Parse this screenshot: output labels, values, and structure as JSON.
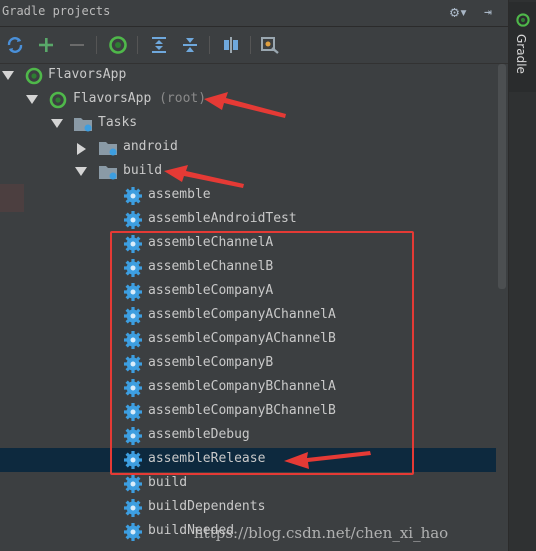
{
  "panel": {
    "title": "Gradle projects",
    "settings_icon": "gear-icon",
    "hide_icon": "hide-panel-icon",
    "side_tab_label": "Gradle"
  },
  "toolbar": {
    "icons": [
      "refresh-icon",
      "add-icon",
      "remove-icon",
      "gradle-execute-icon",
      "expand-all-icon",
      "collapse-all-icon",
      "attach-icon",
      "settings-wrench-icon"
    ]
  },
  "tree": {
    "root_label": "FlavorsApp",
    "module_label": "FlavorsApp",
    "module_hint": "(root)",
    "tasks_label": "Tasks",
    "android_label": "android",
    "build_label": "build",
    "tasks": [
      "assemble",
      "assembleAndroidTest",
      "assembleChannelA",
      "assembleChannelB",
      "assembleCompanyA",
      "assembleCompanyAChannelA",
      "assembleCompanyAChannelB",
      "assembleCompanyB",
      "assembleCompanyBChannelA",
      "assembleCompanyBChannelB",
      "assembleDebug",
      "assembleRelease",
      "build",
      "buildDependents",
      "buildNeeded"
    ],
    "selected_task": "assembleRelease"
  },
  "watermark": "https://blog.csdn.net/chen_xi_hao",
  "colors": {
    "background": "#3c3f41",
    "selection": "#0d293e",
    "annotation_red": "#e53a35",
    "gear_blue": "#3d9ee0",
    "folder": "#8a9aa6",
    "gradle_green": "#4fb84a"
  }
}
